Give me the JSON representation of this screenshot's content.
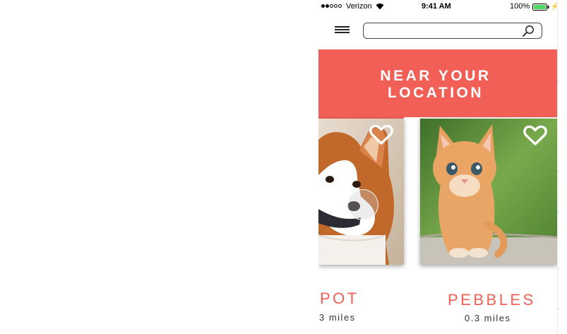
{
  "status_bar": {
    "carrier": "Verizon",
    "time": "9:41 AM",
    "battery": "100%"
  },
  "search": {
    "placeholder": "",
    "value": ""
  },
  "banner": {
    "title_line1": "NEAR YOUR",
    "title_line2": "LOCATION"
  },
  "pets": [
    {
      "name": "POT",
      "distance": "3 miles",
      "image": "corgi-puppy",
      "favorite_icon": "heart-outline-icon"
    },
    {
      "name": "PEBBLES",
      "distance": "0.3 miles",
      "image": "orange-kitten",
      "favorite_icon": "heart-outline-icon"
    }
  ],
  "colors": {
    "accent": "#f25f56",
    "text": "#333333"
  }
}
